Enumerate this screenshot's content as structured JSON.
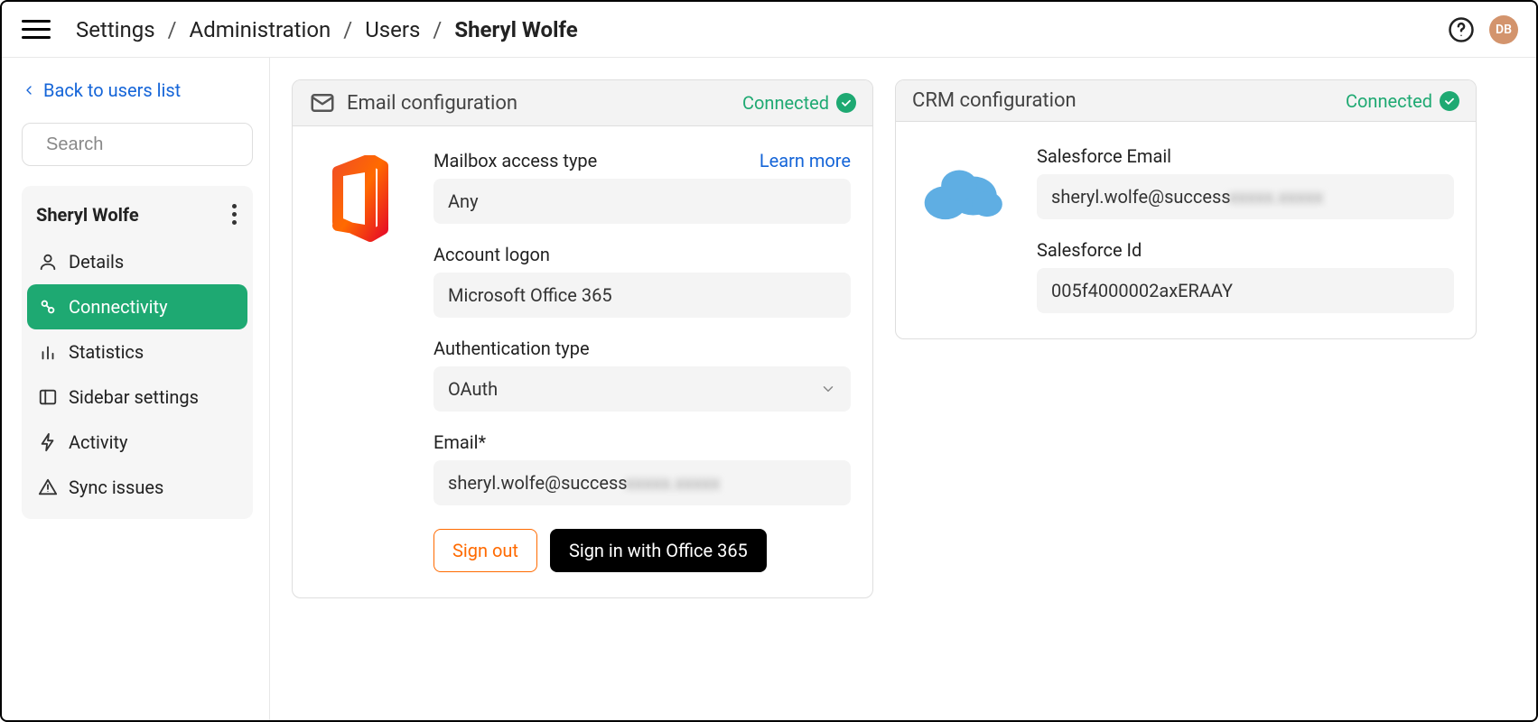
{
  "header": {
    "breadcrumb": [
      "Settings",
      "Administration",
      "Users",
      "Sheryl Wolfe"
    ],
    "avatar_initials": "DB"
  },
  "sidebar": {
    "back_label": "Back to users list",
    "search_placeholder": "Search",
    "user_name": "Sheryl Wolfe",
    "items": [
      {
        "label": "Details"
      },
      {
        "label": "Connectivity"
      },
      {
        "label": "Statistics"
      },
      {
        "label": "Sidebar settings"
      },
      {
        "label": "Activity"
      },
      {
        "label": "Sync issues"
      }
    ],
    "active_index": 1
  },
  "email_card": {
    "title": "Email configuration",
    "status": "Connected",
    "mailbox_access_label": "Mailbox access type",
    "learn_more": "Learn more",
    "mailbox_access_value": "Any",
    "account_logon_label": "Account logon",
    "account_logon_value": "Microsoft Office 365",
    "auth_type_label": "Authentication type",
    "auth_type_value": "OAuth",
    "email_label": "Email*",
    "email_value_visible": "sheryl.wolfe@success",
    "email_value_redacted": "xxxxx.xxxxx",
    "sign_out": "Sign out",
    "sign_in": "Sign in with Office 365"
  },
  "crm_card": {
    "title": "CRM configuration",
    "status": "Connected",
    "sf_email_label": "Salesforce Email",
    "sf_email_visible": "sheryl.wolfe@success",
    "sf_email_redacted": "xxxxx.xxxxx",
    "sf_id_label": "Salesforce Id",
    "sf_id_value": "005f4000002axERAAY"
  }
}
